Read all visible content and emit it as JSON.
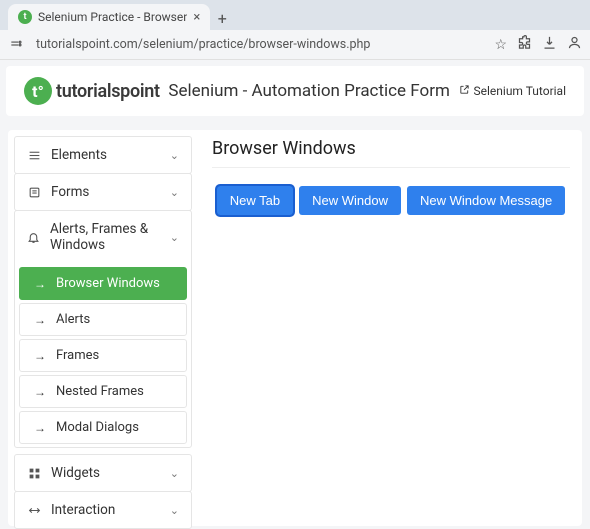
{
  "browser": {
    "tab_title": "Selenium Practice - Browser",
    "url": "tutorialspoint.com/selenium/practice/browser-windows.php"
  },
  "header": {
    "brand": "tutorialspoint",
    "page_title": "Selenium - Automation Practice Form",
    "tutorial_link": "Selenium Tutorial"
  },
  "sidebar": {
    "sections": [
      {
        "label": "Elements"
      },
      {
        "label": "Forms"
      },
      {
        "label": "Alerts, Frames & Windows",
        "items": [
          {
            "label": "Browser Windows",
            "active": true
          },
          {
            "label": "Alerts"
          },
          {
            "label": "Frames"
          },
          {
            "label": "Nested Frames"
          },
          {
            "label": "Modal Dialogs"
          }
        ]
      },
      {
        "label": "Widgets"
      },
      {
        "label": "Interaction"
      }
    ]
  },
  "content": {
    "heading": "Browser Windows",
    "buttons": {
      "new_tab": "New Tab",
      "new_window": "New Window",
      "new_window_message": "New Window Message"
    }
  }
}
